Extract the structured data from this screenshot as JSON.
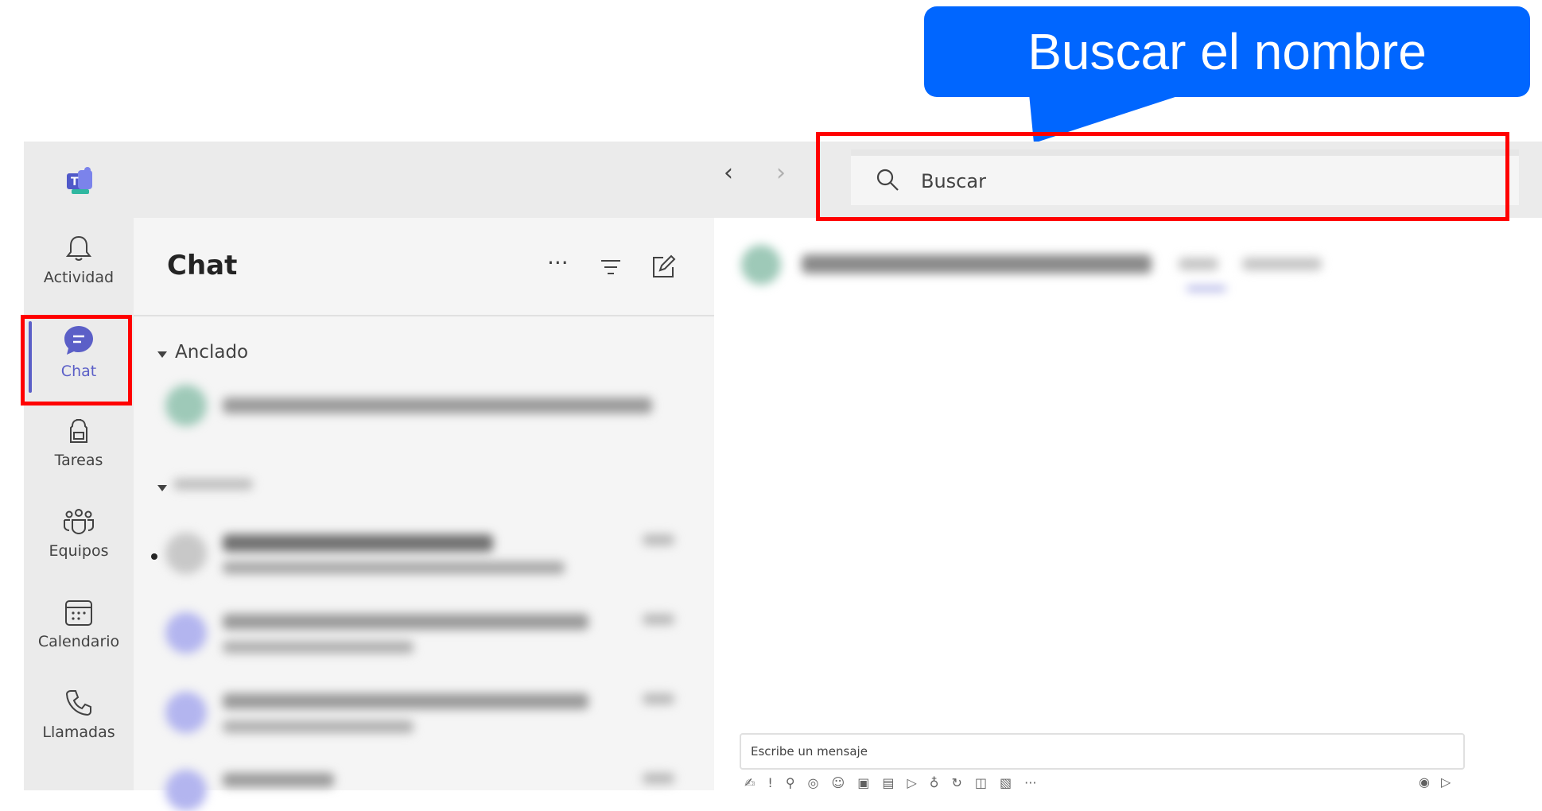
{
  "callout": {
    "text": "Buscar el nombre"
  },
  "search": {
    "placeholder": "Buscar"
  },
  "rail": {
    "items": [
      {
        "label": "Actividad",
        "icon": "bell-icon"
      },
      {
        "label": "Chat",
        "icon": "chat-icon",
        "active": true
      },
      {
        "label": "Tareas",
        "icon": "backpack-icon"
      },
      {
        "label": "Equipos",
        "icon": "teams-icon"
      },
      {
        "label": "Calendario",
        "icon": "calendar-icon"
      },
      {
        "label": "Llamadas",
        "icon": "phone-icon"
      }
    ]
  },
  "chat_panel": {
    "title": "Chat",
    "more_label": "···",
    "pinned_label": "Anclado"
  },
  "compose": {
    "placeholder": "Escribe un mensaje",
    "more_label": "···"
  },
  "colors": {
    "accent": "#5b5fc7",
    "callout": "#0066ff",
    "highlight": "#ff0000"
  }
}
